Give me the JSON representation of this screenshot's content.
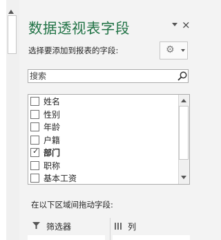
{
  "panel": {
    "title": "数据透视表字段",
    "close_glyph": "×",
    "instruction": "选择要添加到报表的字段:",
    "settings_icon_glyph": "⚙",
    "accent_color": "#217346"
  },
  "search": {
    "placeholder": "搜索"
  },
  "fields": [
    {
      "label": "姓名",
      "checked": false
    },
    {
      "label": "性别",
      "checked": false
    },
    {
      "label": "年龄",
      "checked": false
    },
    {
      "label": "户籍",
      "checked": false
    },
    {
      "label": "部门",
      "checked": true
    },
    {
      "label": "职称",
      "checked": false
    },
    {
      "label": "基本工资",
      "checked": false
    }
  ],
  "areas": {
    "instruction": "在以下区域间拖动字段:",
    "filter_label": "筛选器",
    "columns_label": "列"
  },
  "check_glyph": "✓"
}
